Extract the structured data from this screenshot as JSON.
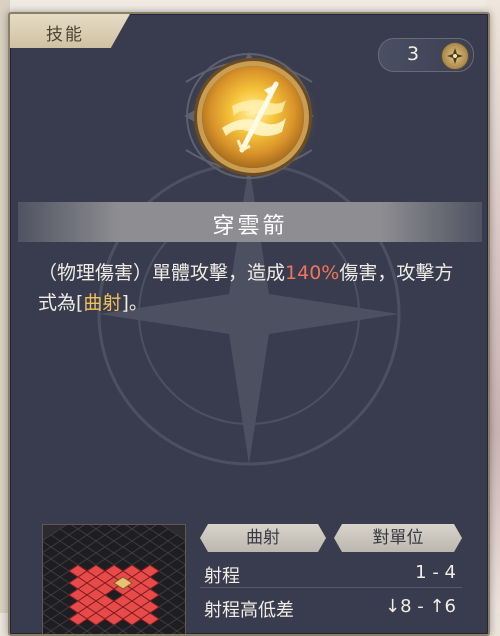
{
  "panel": {
    "tab_label": "技能",
    "counter_value": "3",
    "counter_icon": "compass-star-icon"
  },
  "skill": {
    "icon": "golden-arrow-skill-icon",
    "name": "穿雲箭",
    "description": {
      "part1": "（物理傷害）單體攻擊，造成",
      "damage": "140%",
      "part2": "傷害，攻擊方式為[",
      "attack_type": "曲射",
      "part3": "]。"
    }
  },
  "attack_info": {
    "tag_left": "曲射",
    "tag_right": "對單位",
    "rows": [
      {
        "label": "射程",
        "value": "1 - 4"
      },
      {
        "label": "射程高低差",
        "value": "↓8 - ↑6"
      }
    ]
  },
  "colors": {
    "panel_bg": "#383c4e",
    "accent_red": "#f0745c",
    "accent_gold": "#f2c25a",
    "range_cell": "#e84a4a"
  }
}
